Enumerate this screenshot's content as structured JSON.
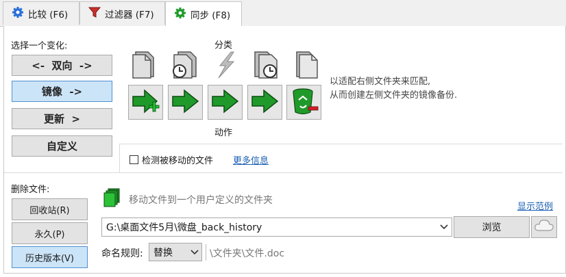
{
  "tabs": [
    {
      "label": "比较 (F6)",
      "icon": "gear-icon"
    },
    {
      "label": "过滤器 (F7)",
      "icon": "filter-icon"
    },
    {
      "label": "同步 (F8)",
      "icon": "gear-icon"
    }
  ],
  "variant": {
    "title": "选择一个变化:",
    "options": [
      "<-  双向  ->",
      "镜像  ->",
      "更新  >",
      "自定义"
    ],
    "selected": "镜像  ->"
  },
  "categories": {
    "header": "分类",
    "footer": "动作",
    "description_line1": "以适配右侧文件夹来匹配,",
    "description_line2": "从而创建左侧文件夹的镜像备份."
  },
  "detect_moved": {
    "label": "检测被移动的文件",
    "checked": false,
    "more_info": "更多信息"
  },
  "deletion": {
    "title": "删除文件:",
    "options": [
      "回收站(R)",
      "永久(P)",
      "历史版本(V)"
    ],
    "selected": "历史版本(V)",
    "move_hint": "移动文件到一个用户定义的文件夹",
    "show_example": "显示范例",
    "path": "G:\\桌面文件5月\\微盘_back_history",
    "browse": "浏览",
    "naming_label": "命名规则:",
    "naming_value": "替换",
    "naming_example": "\\文件夹\\文件.doc"
  },
  "colors": {
    "accent": "#cce4f7",
    "link": "#1a5fb4",
    "green": "#1f9a2a",
    "red": "#d0202a"
  }
}
